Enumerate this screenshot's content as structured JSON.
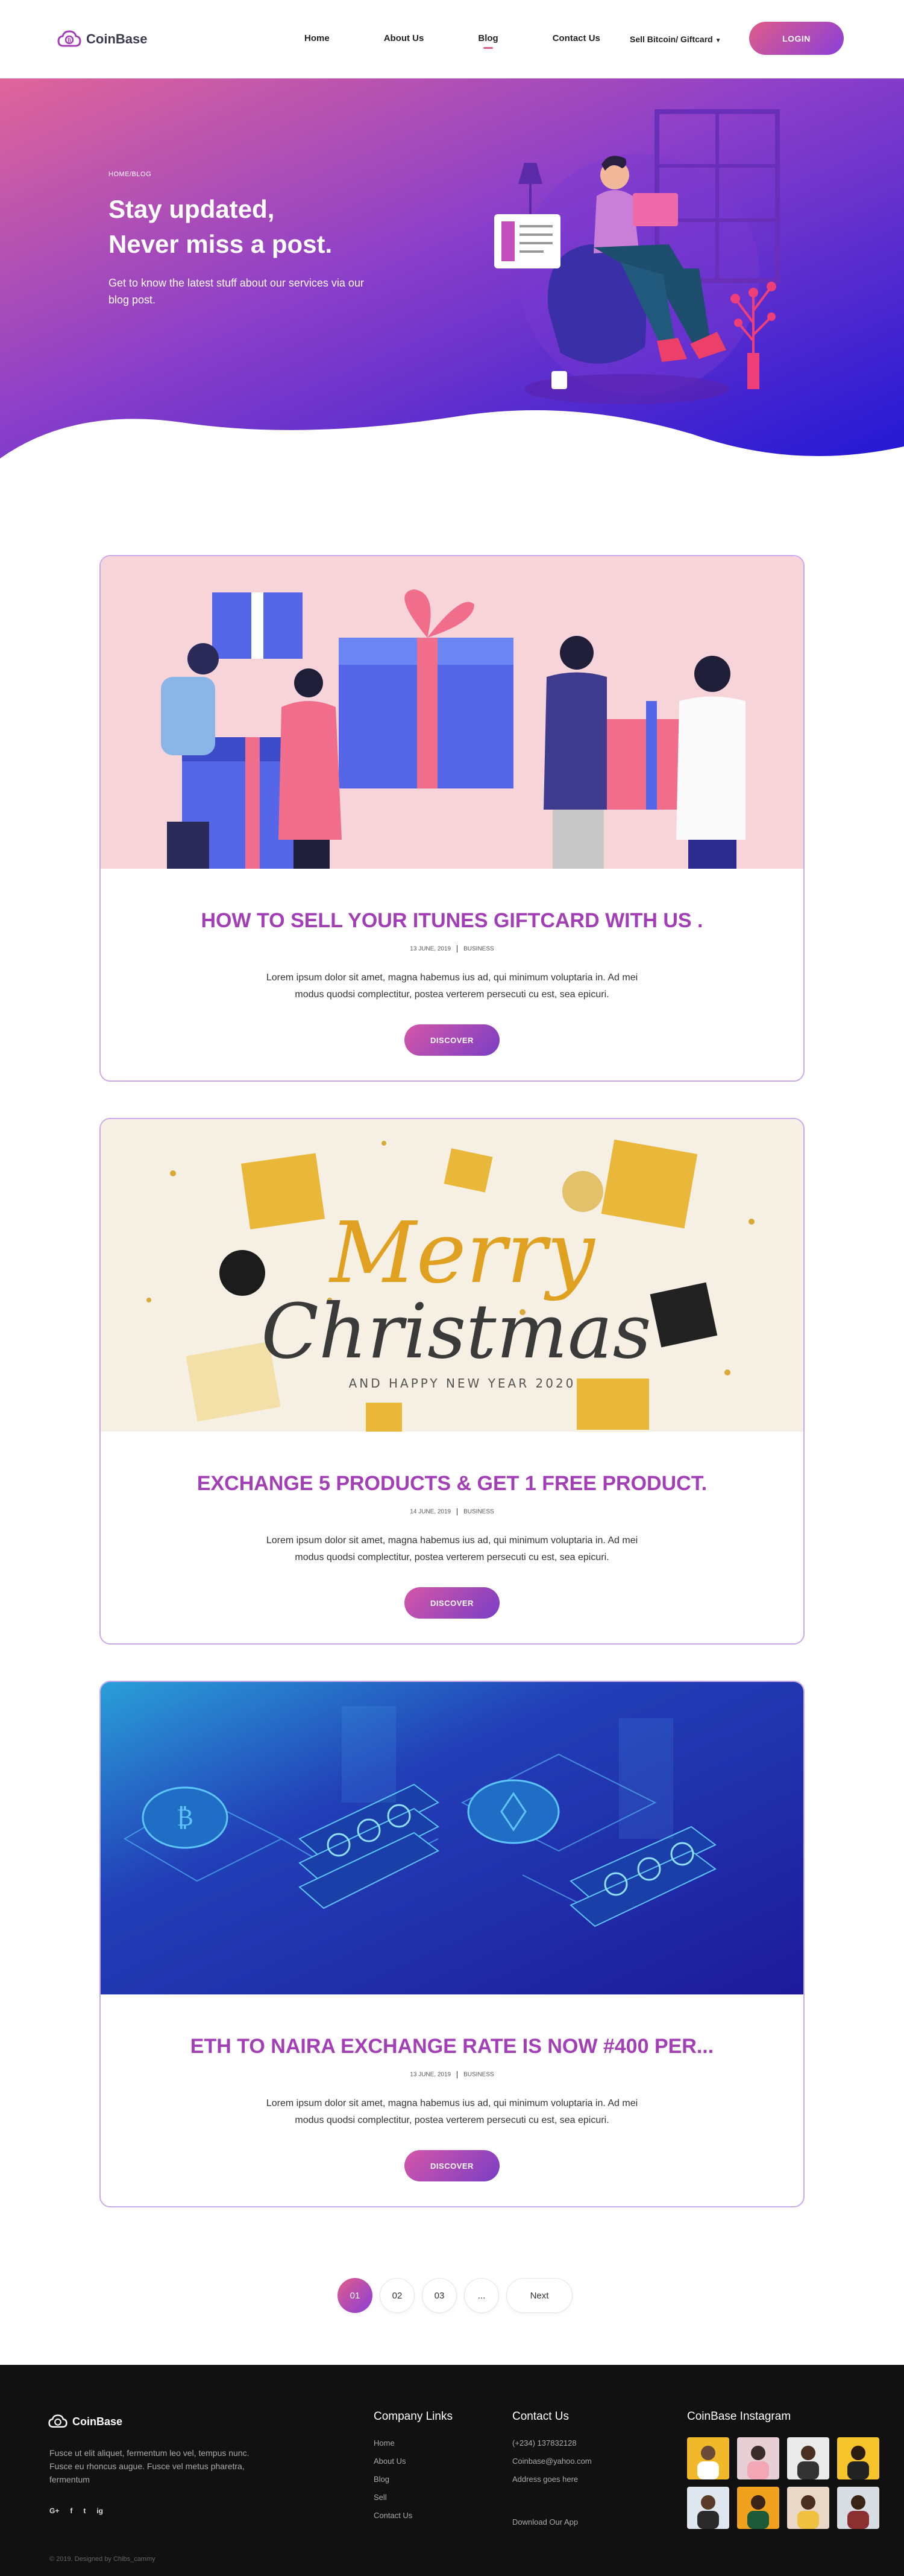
{
  "nav": {
    "logo_text": "CoinBase",
    "items": [
      {
        "label": "Home"
      },
      {
        "label": "About Us"
      },
      {
        "label": "Blog"
      },
      {
        "label": "Contact Us"
      }
    ],
    "sell_dropdown": "Sell Bitcoin/ Giftcard",
    "login_label": "LOGIN"
  },
  "hero": {
    "breadcrumb": "HOME/BLOG",
    "title_line1": "Stay updated,",
    "title_line2": "Never miss a post.",
    "subtitle": "Get to know the latest stuff about our services via our blog post."
  },
  "posts": [
    {
      "title": "HOW TO SELL YOUR ITUNES GIFTCARD WITH US .",
      "date": "13 JUNE, 2019",
      "category": "BUSINESS",
      "excerpt": "Lorem ipsum dolor sit amet, magna habemus ius ad, qui minimum voluptaria in. Ad mei modus quodsi complectitur, postea verterem persecuti cu est, sea epicuri.",
      "button": "DISCOVER"
    },
    {
      "title": "EXCHANGE 5 PRODUCTS & GET 1 FREE PRODUCT.",
      "date": "14 JUNE, 2019",
      "category": "BUSINESS",
      "excerpt": "Lorem ipsum dolor sit amet, magna habemus ius ad, qui minimum voluptaria in. Ad mei modus quodsi complectitur, postea verterem persecuti cu est, sea epicuri.",
      "button": "DISCOVER",
      "image_text_1": "Merry",
      "image_text_2": "Christmas",
      "image_text_3": "AND HAPPY NEW YEAR 2020"
    },
    {
      "title": "ETH TO NAIRA EXCHANGE RATE IS NOW #400 PER...",
      "date": "13 JUNE, 2019",
      "category": "BUSINESS",
      "excerpt": "Lorem ipsum dolor sit amet, magna habemus ius ad, qui minimum voluptaria in. Ad mei modus quodsi complectitur, postea verterem persecuti cu est, sea epicuri.",
      "button": "DISCOVER"
    }
  ],
  "pagination": {
    "pages": [
      "01",
      "02",
      "03",
      "..."
    ],
    "active": "01",
    "next": "Next"
  },
  "footer": {
    "logo_text": "CoinBase",
    "about": "Fusce ut elit aliquet, fermentum leo vel, tempus nunc. Fusce eu rhoncus augue. Fusce vel metus pharetra, fermentum",
    "social": [
      "G+",
      "f",
      "t",
      "ig"
    ],
    "company_title": "Company Links",
    "company_links": [
      "Home",
      "About Us",
      "Blog",
      "Sell",
      "Contact Us"
    ],
    "contact_title": "Contact Us",
    "contact_lines": [
      "(+234) 137832128",
      "Coinbase@yahoo.com",
      "Address goes here"
    ],
    "download": "Download Our App",
    "instagram_title": "CoinBase Instagram",
    "copyright": "© 2019. Designed by Chibs_cammy"
  },
  "colors": {
    "accent_pink": "#e05c8a",
    "accent_purple": "#8a3fd8",
    "title_purple": "#a33fb6",
    "footer_bg": "#111111"
  }
}
